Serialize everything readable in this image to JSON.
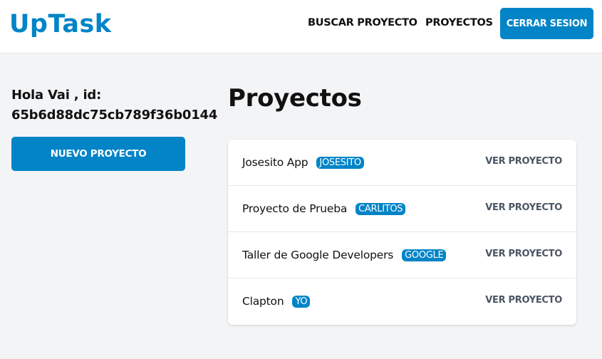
{
  "header": {
    "logo": "UpTask",
    "nav": {
      "search_label": "BUSCAR PROYECTO",
      "projects_label": "PROYECTOS",
      "logout_label": "CERRAR SESION"
    }
  },
  "sidebar": {
    "greeting": "Hola Vai , id: 65b6d88dc75cb789f36b0144",
    "new_project_label": "NUEVO PROYECTO"
  },
  "main": {
    "title": "Proyectos",
    "projects": [
      {
        "name": "Josesito App",
        "client": "JOSESITO",
        "action": "VER PROYECTO"
      },
      {
        "name": "Proyecto de Prueba",
        "client": "CARLITOS",
        "action": "VER PROYECTO"
      },
      {
        "name": "Taller de Google Developers",
        "client": "GOOGLE",
        "action": "VER PROYECTO"
      },
      {
        "name": "Clapton",
        "client": "YO",
        "action": "VER PROYECTO"
      }
    ]
  },
  "colors": {
    "accent": "#0284c7",
    "background": "#f3f4f6",
    "card": "#ffffff"
  }
}
